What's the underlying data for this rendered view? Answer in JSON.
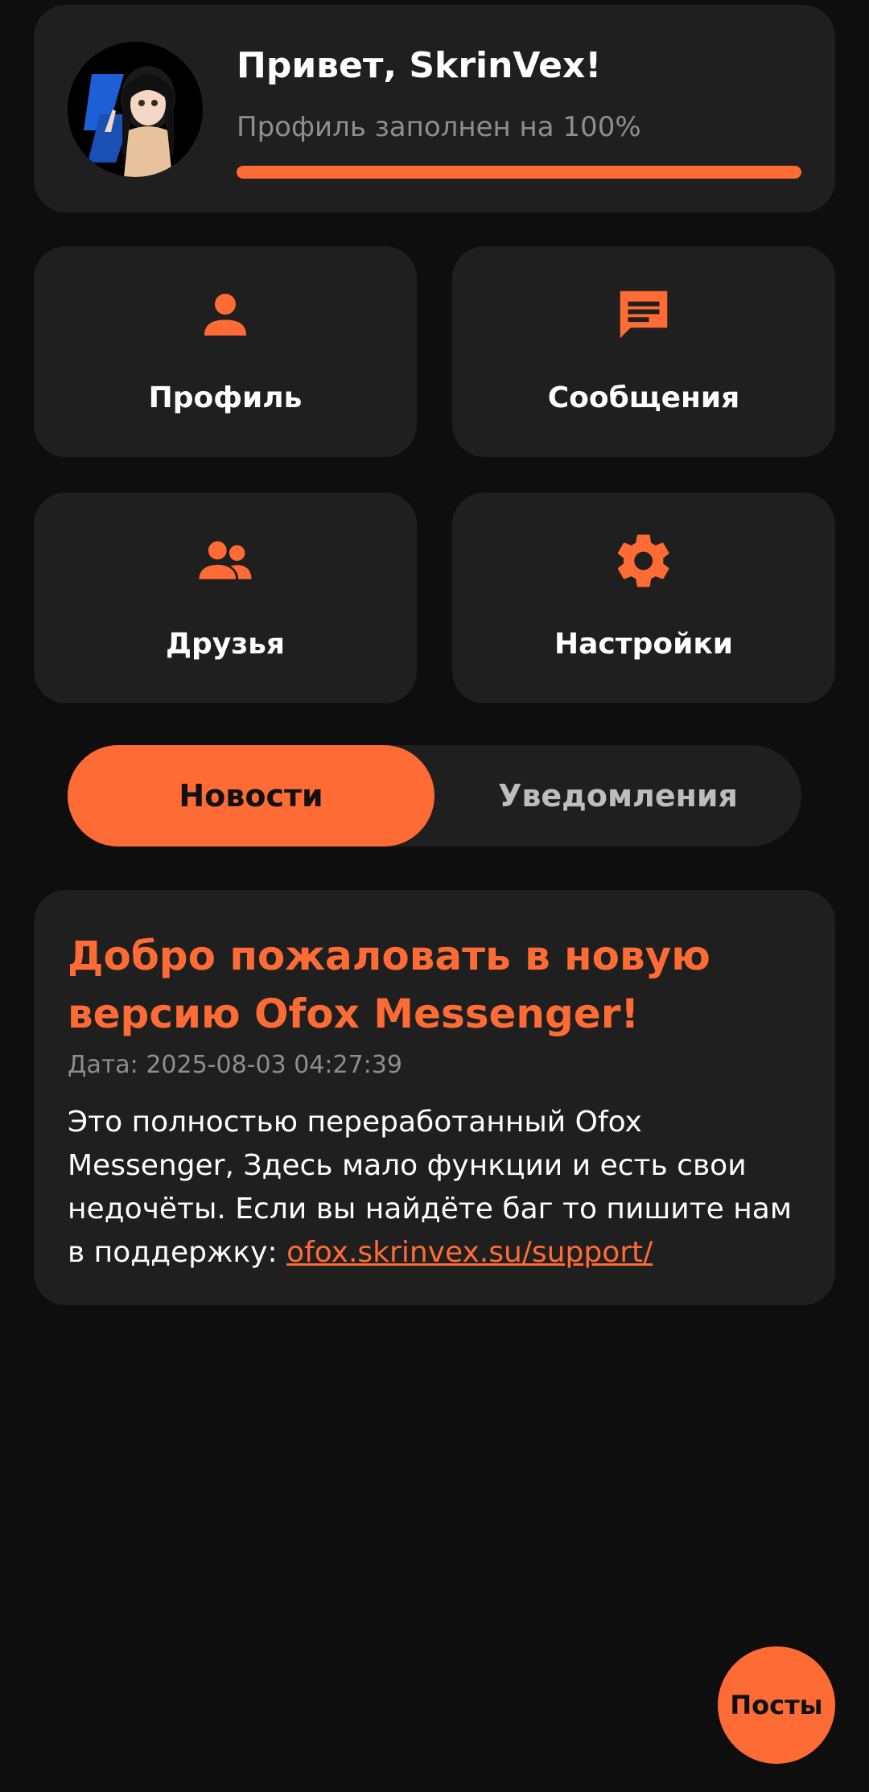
{
  "header": {
    "greeting": "Привет, SkrinVex!",
    "profile_status": "Профиль заполнен на 100%",
    "profile_progress": 1.0
  },
  "tiles": [
    {
      "label": "Профиль",
      "icon": "person-icon"
    },
    {
      "label": "Сообщения",
      "icon": "chat-icon"
    },
    {
      "label": "Друзья",
      "icon": "group-icon"
    },
    {
      "label": "Настройки",
      "icon": "gear-icon"
    }
  ],
  "tabs": [
    {
      "label": "Новости",
      "active": true
    },
    {
      "label": "Уведомления",
      "active": false
    }
  ],
  "news": {
    "title": "Добро пожаловать в новую версию Ofox Messenger!",
    "date": "Дата: 2025-08-03 04:27:39",
    "body": "Это полностью переработанный Ofox Messenger, Здесь мало функции и есть свои недочёты. Если вы найдёте баг то пишите нам в поддержку: ",
    "link": "ofox.skrinvex.su/support/"
  },
  "fab": {
    "label": "Посты"
  },
  "colors": {
    "accent": "#ff6b35",
    "background": "#0e0e0e",
    "card": "#1f1f1f",
    "muted_text": "#8e8e8e"
  }
}
